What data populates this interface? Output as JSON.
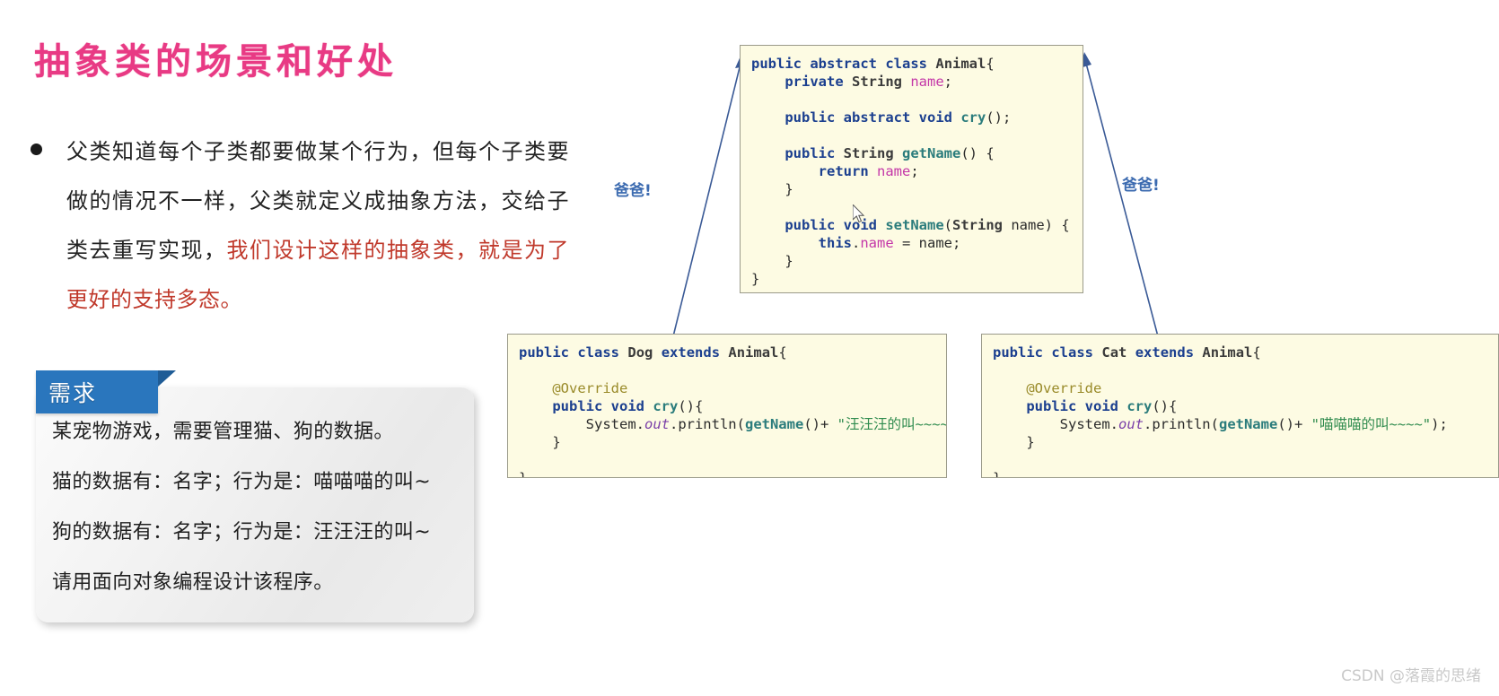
{
  "slide": {
    "title": "抽象类的场景和好处",
    "title_color": "#e83a84",
    "bullet": {
      "dot": "•",
      "lines": [
        {
          "text": "父类知道每个子类都要做某个行为，但每个子类要",
          "color": "normal"
        },
        {
          "text": "做的情况不一样，父类就定义成抽象方法，交给子",
          "color": "normal"
        },
        {
          "text_normal": "类去重写实现，",
          "text_highlight": "我们设计这样的抽象类，就是为了",
          "color": "mixed"
        },
        {
          "text": "更好的支持多态。",
          "color": "highlight"
        }
      ],
      "highlight_color": "#c0392b"
    },
    "requirement_card": {
      "tab_label": "需求",
      "tab_color": "#2a76bd",
      "lines": [
        "某宠物游戏，需要管理猫、狗的数据。",
        "猫的数据有：名字；行为是：喵喵喵的叫~",
        "狗的数据有：名字；行为是：汪汪汪的叫~",
        "请用面向对象编程设计该程序。"
      ]
    }
  },
  "diagram": {
    "parent_label_left": "爸爸!",
    "parent_label_right": "爸爸!",
    "label_color": "#3c6bb0",
    "arrow_color": "#3a5a96",
    "code_blocks": {
      "animal": {
        "name": "Animal",
        "bg": "#fdfbe3",
        "lines": [
          [
            {
              "t": "public",
              "c": "kw"
            },
            {
              "t": " ",
              "c": "pl"
            },
            {
              "t": "abstract",
              "c": "kw"
            },
            {
              "t": " ",
              "c": "pl"
            },
            {
              "t": "class",
              "c": "kw"
            },
            {
              "t": " ",
              "c": "pl"
            },
            {
              "t": "Animal",
              "c": "cls"
            },
            {
              "t": "{",
              "c": "pl"
            }
          ],
          [
            {
              "t": "    ",
              "c": "pl"
            },
            {
              "t": "private",
              "c": "kw"
            },
            {
              "t": " ",
              "c": "pl"
            },
            {
              "t": "String",
              "c": "cls"
            },
            {
              "t": " ",
              "c": "pl"
            },
            {
              "t": "name",
              "c": "fld"
            },
            {
              "t": ";",
              "c": "pl"
            }
          ],
          [
            {
              "t": "",
              "c": "pl"
            }
          ],
          [
            {
              "t": "    ",
              "c": "pl"
            },
            {
              "t": "public",
              "c": "kw"
            },
            {
              "t": " ",
              "c": "pl"
            },
            {
              "t": "abstract",
              "c": "kw"
            },
            {
              "t": " ",
              "c": "pl"
            },
            {
              "t": "void",
              "c": "kw"
            },
            {
              "t": " ",
              "c": "pl"
            },
            {
              "t": "cry",
              "c": "mth"
            },
            {
              "t": "();",
              "c": "pl"
            }
          ],
          [
            {
              "t": "",
              "c": "pl"
            }
          ],
          [
            {
              "t": "    ",
              "c": "pl"
            },
            {
              "t": "public",
              "c": "kw"
            },
            {
              "t": " ",
              "c": "pl"
            },
            {
              "t": "String",
              "c": "cls"
            },
            {
              "t": " ",
              "c": "pl"
            },
            {
              "t": "getName",
              "c": "mth"
            },
            {
              "t": "() {",
              "c": "pl"
            }
          ],
          [
            {
              "t": "        ",
              "c": "pl"
            },
            {
              "t": "return",
              "c": "kw"
            },
            {
              "t": " ",
              "c": "pl"
            },
            {
              "t": "name",
              "c": "fld"
            },
            {
              "t": ";",
              "c": "pl"
            }
          ],
          [
            {
              "t": "    }",
              "c": "pl"
            }
          ],
          [
            {
              "t": "",
              "c": "pl"
            }
          ],
          [
            {
              "t": "    ",
              "c": "pl"
            },
            {
              "t": "public",
              "c": "kw"
            },
            {
              "t": " ",
              "c": "pl"
            },
            {
              "t": "void",
              "c": "kw"
            },
            {
              "t": " ",
              "c": "pl"
            },
            {
              "t": "setName",
              "c": "mth"
            },
            {
              "t": "(",
              "c": "pl"
            },
            {
              "t": "String",
              "c": "cls"
            },
            {
              "t": " name) {",
              "c": "pl"
            }
          ],
          [
            {
              "t": "        ",
              "c": "pl"
            },
            {
              "t": "this",
              "c": "kw"
            },
            {
              "t": ".",
              "c": "pl"
            },
            {
              "t": "name",
              "c": "fld"
            },
            {
              "t": " = name;",
              "c": "pl"
            }
          ],
          [
            {
              "t": "    }",
              "c": "pl"
            }
          ],
          [
            {
              "t": "}",
              "c": "pl"
            }
          ]
        ]
      },
      "dog": {
        "name": "Dog",
        "bg": "#fdfbe3",
        "lines": [
          [
            {
              "t": "public",
              "c": "kw"
            },
            {
              "t": " ",
              "c": "pl"
            },
            {
              "t": "class",
              "c": "kw"
            },
            {
              "t": " ",
              "c": "pl"
            },
            {
              "t": "Dog",
              "c": "cls"
            },
            {
              "t": " ",
              "c": "pl"
            },
            {
              "t": "extends",
              "c": "kw"
            },
            {
              "t": " ",
              "c": "pl"
            },
            {
              "t": "Animal",
              "c": "cls"
            },
            {
              "t": "{",
              "c": "pl"
            }
          ],
          [
            {
              "t": "",
              "c": "pl"
            }
          ],
          [
            {
              "t": "    ",
              "c": "pl"
            },
            {
              "t": "@Override",
              "c": "ann"
            }
          ],
          [
            {
              "t": "    ",
              "c": "pl"
            },
            {
              "t": "public",
              "c": "kw"
            },
            {
              "t": " ",
              "c": "pl"
            },
            {
              "t": "void",
              "c": "kw"
            },
            {
              "t": " ",
              "c": "pl"
            },
            {
              "t": "cry",
              "c": "mth"
            },
            {
              "t": "(){",
              "c": "pl"
            }
          ],
          [
            {
              "t": "        System.",
              "c": "pl"
            },
            {
              "t": "out",
              "c": "ital"
            },
            {
              "t": ".println(",
              "c": "pl"
            },
            {
              "t": "getName",
              "c": "mth"
            },
            {
              "t": "()+ ",
              "c": "pl"
            },
            {
              "t": "\"汪汪汪的叫~~~~\"",
              "c": "str"
            },
            {
              "t": ");",
              "c": "pl"
            }
          ],
          [
            {
              "t": "    }",
              "c": "pl"
            }
          ],
          [
            {
              "t": "",
              "c": "pl"
            }
          ],
          [
            {
              "t": "}",
              "c": "pl"
            }
          ]
        ]
      },
      "cat": {
        "name": "Cat",
        "bg": "#fdfbe3",
        "lines": [
          [
            {
              "t": "public",
              "c": "kw"
            },
            {
              "t": " ",
              "c": "pl"
            },
            {
              "t": "class",
              "c": "kw"
            },
            {
              "t": " ",
              "c": "pl"
            },
            {
              "t": "Cat",
              "c": "cls"
            },
            {
              "t": " ",
              "c": "pl"
            },
            {
              "t": "extends",
              "c": "kw"
            },
            {
              "t": " ",
              "c": "pl"
            },
            {
              "t": "Animal",
              "c": "cls"
            },
            {
              "t": "{",
              "c": "pl"
            }
          ],
          [
            {
              "t": "",
              "c": "pl"
            }
          ],
          [
            {
              "t": "    ",
              "c": "pl"
            },
            {
              "t": "@Override",
              "c": "ann"
            }
          ],
          [
            {
              "t": "    ",
              "c": "pl"
            },
            {
              "t": "public",
              "c": "kw"
            },
            {
              "t": " ",
              "c": "pl"
            },
            {
              "t": "void",
              "c": "kw"
            },
            {
              "t": " ",
              "c": "pl"
            },
            {
              "t": "cry",
              "c": "mth"
            },
            {
              "t": "(){",
              "c": "pl"
            }
          ],
          [
            {
              "t": "        System.",
              "c": "pl"
            },
            {
              "t": "out",
              "c": "ital"
            },
            {
              "t": ".println(",
              "c": "pl"
            },
            {
              "t": "getName",
              "c": "mth"
            },
            {
              "t": "()+ ",
              "c": "pl"
            },
            {
              "t": "\"喵喵喵的叫~~~~\"",
              "c": "str"
            },
            {
              "t": ");",
              "c": "pl"
            }
          ],
          [
            {
              "t": "    }",
              "c": "pl"
            }
          ],
          [
            {
              "t": "",
              "c": "pl"
            }
          ],
          [
            {
              "t": "}",
              "c": "pl"
            }
          ]
        ]
      }
    }
  },
  "watermark": "CSDN @落霞的思绪"
}
